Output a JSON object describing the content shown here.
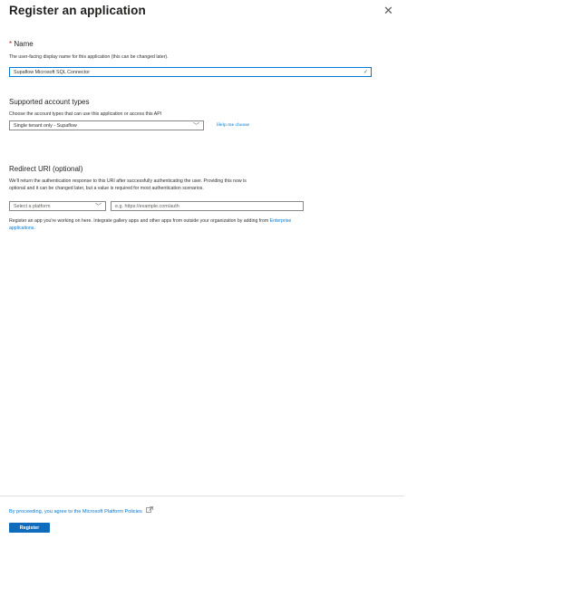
{
  "header": {
    "title": "Register an application",
    "more_label": "· ·",
    "close_label": "✕"
  },
  "name_section": {
    "required_mark": "*",
    "title": "Name",
    "description": "The user-facing display name for this application (this can be changed later).",
    "value": "Supaflow Microsoft SQL Connector",
    "valid_icon": "checkmark-icon"
  },
  "account_types": {
    "title": "Supported account types",
    "description": "Choose the account types that can use this application or access this API",
    "selected": "Single tenant only - Supaflow",
    "help_label": "Help me choose"
  },
  "redirect": {
    "title": "Redirect URI (optional)",
    "description_line1": "We'll return the authentication response to this URI after successfully authenticating the user. Providing this now is",
    "description_line2": "optional and it can be changed later, but a value is required for most authentication scenarios.",
    "platform_placeholder": "Select a platform",
    "uri_placeholder": "e.g. https://example.com/auth",
    "info_line1_prefix": "Register an app you're working on here. Integrate gallery apps and other apps from outside your organization by adding from",
    "info_link_part1": "Enterprise",
    "info_link_part2": "applications",
    "info_suffix": "."
  },
  "footer": {
    "policies_text": "By proceeding, you agree to the Microsoft Platform Policies",
    "external_icon": "external-link-icon",
    "register_label": "Register"
  },
  "colors": {
    "accent": "#0078d4",
    "button": "#0f6cbd",
    "required": "#a4262c",
    "valid": "#107c10"
  }
}
